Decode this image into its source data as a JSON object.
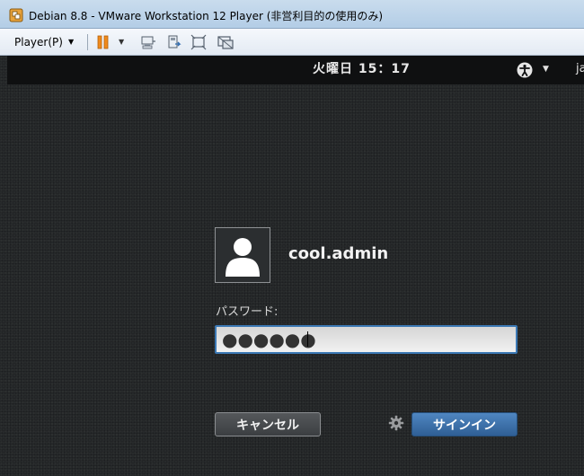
{
  "window": {
    "title": "Debian 8.8 - VMware Workstation 12 Player (非営利目的の使用のみ)",
    "icon": "vmware-player-icon"
  },
  "toolbar": {
    "player_menu_label": "Player(P)",
    "icons": [
      "pause-icon",
      "send-ctrl-alt-del-icon",
      "removable-devices-icon",
      "fullscreen-icon",
      "unity-icon"
    ],
    "pause_color": "#f08a1c"
  },
  "gnome": {
    "clock": "火曜日 15：17",
    "language": "ja",
    "icons": [
      "accessibility-icon",
      "session-gear-icon",
      "user-avatar-icon"
    ]
  },
  "login": {
    "username": "cool.admin",
    "password_label": "パスワード:",
    "password_value": "●●●●●●",
    "cancel_label": "キャンセル",
    "signin_label": "サインイン",
    "accent_color": "#3b78b4"
  }
}
